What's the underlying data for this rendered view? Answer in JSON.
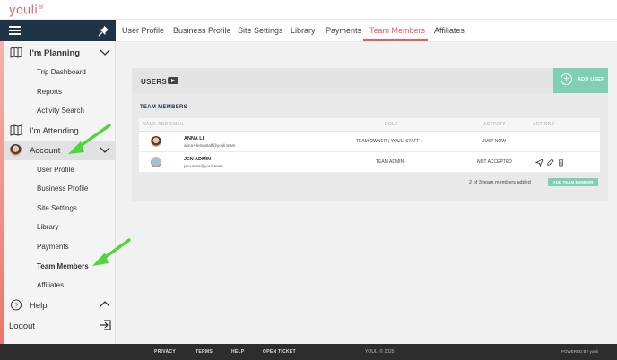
{
  "brand": {
    "logo": "youli",
    "logo_mark": "®"
  },
  "sidebar": {
    "items": [
      {
        "label": "I'm Planning",
        "type": "group"
      },
      {
        "label": "Trip Dashboard"
      },
      {
        "label": "Reports"
      },
      {
        "label": "Activity Search"
      },
      {
        "label": "I'm Attending",
        "type": "group"
      },
      {
        "label": "Account",
        "type": "group"
      },
      {
        "label": "User Profile"
      },
      {
        "label": "Business Profile"
      },
      {
        "label": "Site Settings"
      },
      {
        "label": "Library"
      },
      {
        "label": "Payments"
      },
      {
        "label": "Team Members",
        "active": true
      },
      {
        "label": "Affiliates"
      },
      {
        "label": "Help",
        "type": "group"
      },
      {
        "label": "Logout"
      }
    ]
  },
  "tabs": [
    "User Profile",
    "Business Profile",
    "Site Settings",
    "Library",
    "Payments",
    "Team Members",
    "Affiliates"
  ],
  "active_tab": "Team Members",
  "users": {
    "title": "USERS",
    "add_user": "ADD USER",
    "section_title": "TEAM MEMBERS",
    "columns": [
      "NAME AND EMAIL",
      "ROLE",
      "ACTIVITY",
      "ACTIONS"
    ],
    "rows": [
      {
        "name": "ANNA LI",
        "email": "anna+demostaff@youli.team",
        "role": "TEAM OWNER ( YOULI STAFF )",
        "activity": "JUST NOW"
      },
      {
        "name": "JEN ADMIN",
        "email": "jen+anna@youli.team",
        "role": "TEAM ADMIN",
        "activity": "NOT ACCEPTED"
      }
    ],
    "count_text": "2 of 3 team members added",
    "add_team_member": "ADD TEAM MEMBER"
  },
  "footer": {
    "links": [
      "PRIVACY",
      "TERMS",
      "HELP",
      "OPEN TICKET"
    ],
    "copyright": "YOULI © 2025",
    "powered": "POWERED BY youli"
  },
  "colors": {
    "accent": "#e0605a",
    "navy": "#1f3446",
    "teal": "#7ecfb3",
    "arrow": "#4fd63c"
  }
}
